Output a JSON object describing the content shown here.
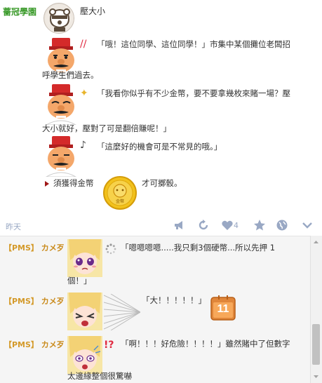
{
  "club": {
    "name": "薔冠學園",
    "title": "壓大小"
  },
  "post": {
    "lines": [
      "「哦！這位同學、這位同學！」市集中某個攤位老闆招",
      "呼學生們過去。",
      "「我看你似乎有不少金幣，要不要拿幾枚來賭一場？壓",
      "大小就好，壓對了可是翻倍賺呢！」",
      "「這麼好的機會可是不常見的哦。」",
      "須獲得金幣",
      "才可擲骰。"
    ],
    "emotes": [
      "shock-marks",
      "sparkle",
      "music-note"
    ],
    "coin_label": "金幣"
  },
  "meta": {
    "time": "昨天",
    "like_count": "4",
    "icons": [
      "megaphone-icon",
      "refresh-icon",
      "heart-icon",
      "star-icon",
      "globe-icon",
      "chevron-down-icon"
    ]
  },
  "comments": [
    {
      "tag": "【PMS】",
      "name": "カメ歹",
      "lines": [
        "「嗯嗯嗯嗯.....我只剩3個硬幣...所以先押 1",
        "個！」"
      ]
    },
    {
      "tag": "【PMS】",
      "name": "カメ歹",
      "lines": [
        "「大！！！！！」"
      ],
      "dice": "11"
    },
    {
      "tag": "【PMS】",
      "name": "カメ歹",
      "lines": [
        "「啊！！！好危險！！！！」雖然賭中了但數字",
        "太邊緣整個很驚嚇"
      ]
    }
  ],
  "colors": {
    "club": "#3a9a2a",
    "meta": "#99a8c4",
    "pms": "#c98a1a",
    "comment_bg": "#f5f5f5"
  }
}
